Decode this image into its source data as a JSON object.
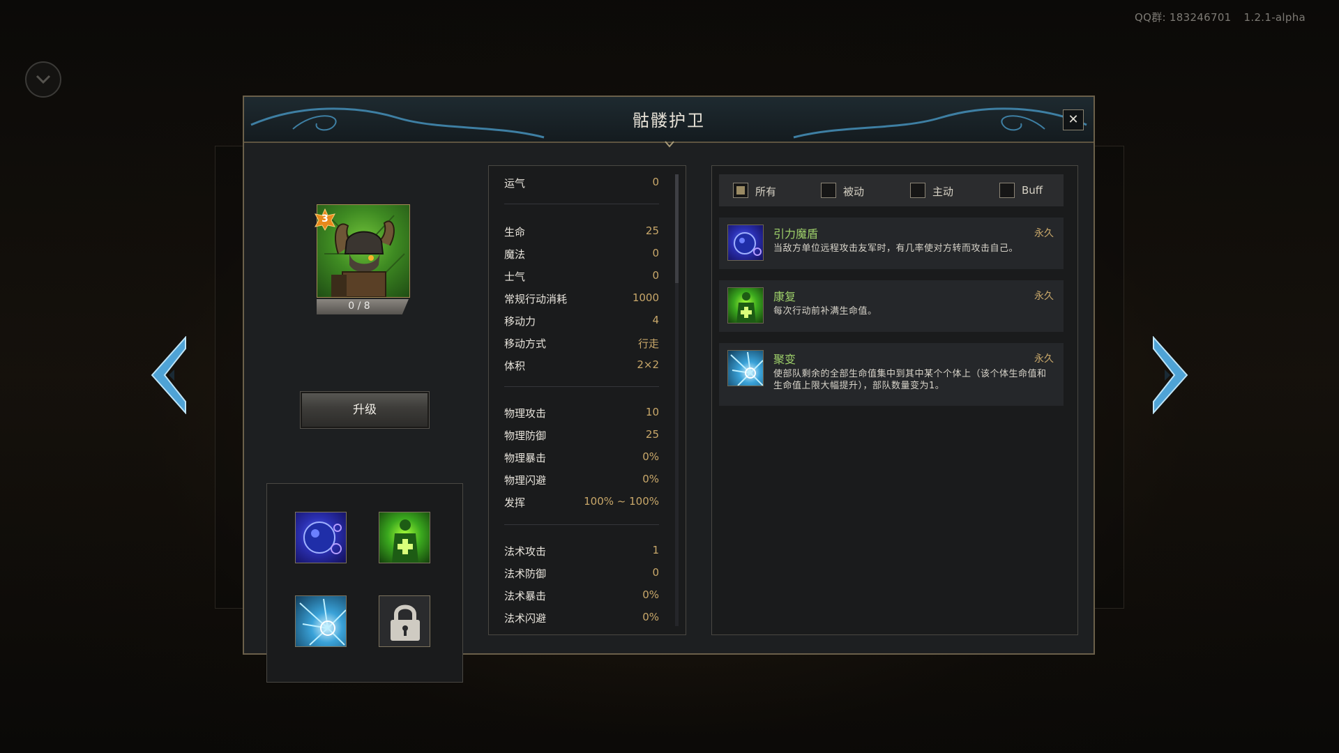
{
  "version": {
    "qq_group": "QQ群: 183246701",
    "build": "1.2.1-alpha"
  },
  "dialog": {
    "title": "骷髅护卫",
    "close_label": "✕"
  },
  "unit": {
    "level": "3",
    "xp": "0 / 8",
    "upgrade_label": "升级",
    "icon": "skeleton-guard-portrait"
  },
  "skills": [
    {
      "name": "gravity-shield-icon",
      "locked": false
    },
    {
      "name": "regeneration-icon",
      "locked": false
    },
    {
      "name": "fission-icon",
      "locked": false
    },
    {
      "name": "lock-icon",
      "locked": true
    }
  ],
  "stats": {
    "group1": [
      {
        "label": "运气",
        "value": "0"
      }
    ],
    "group2": [
      {
        "label": "生命",
        "value": "25"
      },
      {
        "label": "魔法",
        "value": "0"
      },
      {
        "label": "士气",
        "value": "0"
      },
      {
        "label": "常规行动消耗",
        "value": "1000"
      },
      {
        "label": "移动力",
        "value": "4"
      },
      {
        "label": "移动方式",
        "value": "行走"
      },
      {
        "label": "体积",
        "value": "2×2"
      }
    ],
    "group3": [
      {
        "label": "物理攻击",
        "value": "10"
      },
      {
        "label": "物理防御",
        "value": "25"
      },
      {
        "label": "物理暴击",
        "value": "0%"
      },
      {
        "label": "物理闪避",
        "value": "0%"
      },
      {
        "label": "发挥",
        "value": "100% ~ 100%"
      }
    ],
    "group4": [
      {
        "label": "法术攻击",
        "value": "1"
      },
      {
        "label": "法术防御",
        "value": "0"
      },
      {
        "label": "法术暴击",
        "value": "0%"
      },
      {
        "label": "法术闪避",
        "value": "0%"
      }
    ]
  },
  "filters": [
    {
      "label": "所有",
      "checked": true
    },
    {
      "label": "被动",
      "checked": false
    },
    {
      "label": "主动",
      "checked": false
    },
    {
      "label": "Buff",
      "checked": false
    }
  ],
  "effects": [
    {
      "name": "引力魔盾",
      "duration": "永久",
      "desc": "当敌方单位远程攻击友军时，有几率使对方转而攻击自己。",
      "icon": "gravity-shield-icon"
    },
    {
      "name": "康复",
      "duration": "永久",
      "desc": "每次行动前补满生命值。",
      "icon": "regeneration-icon"
    },
    {
      "name": "聚变",
      "duration": "永久",
      "desc": "使部队剩余的全部生命值集中到其中某个个体上（该个体生命值和生命值上限大幅提升），部队数量变为1。",
      "icon": "fission-icon"
    }
  ],
  "colors": {
    "accent_gold": "#c9a86a",
    "effect_name_green": "#9ed06a",
    "frame": "#6b604a",
    "arrow_blue": "#4fa3d6"
  }
}
